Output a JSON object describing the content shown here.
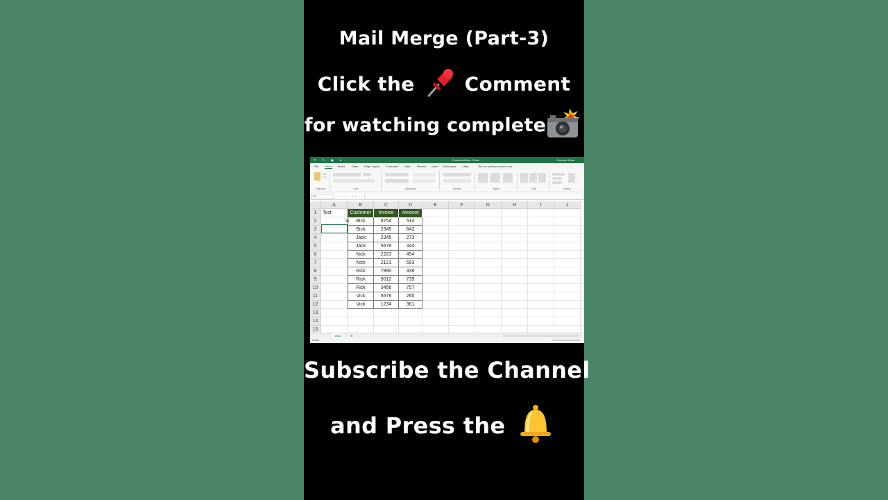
{
  "headline": {
    "line1": "Mail Merge (Part-3)",
    "line2_a": "Click the",
    "line2_b": "Comment",
    "line3": "for watching complete",
    "line4": "Subscribe the Channel",
    "line5": "and Press the"
  },
  "icons": {
    "pin": "pushpin-icon",
    "camera": "camera-flash-icon",
    "bell": "bell-icon"
  },
  "excel": {
    "title": "CustomerData - Excel",
    "user": "Khurram Khan",
    "tabs": [
      "File",
      "Home",
      "Insert",
      "Draw",
      "Page Layout",
      "Formulas",
      "Data",
      "Review",
      "View",
      "Developer",
      "Help",
      "Tell me what you want to do"
    ],
    "groups": [
      "Clipboard",
      "Font",
      "Alignment",
      "Number",
      "Styles",
      "Cells",
      "Editing"
    ],
    "name_box": "A1",
    "columns": [
      "A",
      "B",
      "C",
      "D",
      "E",
      "F",
      "G",
      "H",
      "I",
      "J"
    ],
    "rows": [
      "1",
      "2",
      "3",
      "4",
      "5",
      "6",
      "7",
      "8",
      "9",
      "10",
      "11",
      "12",
      "13",
      "14",
      "15"
    ],
    "a1": "Test",
    "headers": [
      "Customer",
      "Invoice",
      "Amount"
    ],
    "data": [
      [
        "Bick",
        "6754",
        "514"
      ],
      [
        "Bick",
        "2345",
        "642"
      ],
      [
        "Jack",
        "2345",
        "273"
      ],
      [
        "Jack",
        "5678",
        "344"
      ],
      [
        "Nick",
        "2223",
        "454"
      ],
      [
        "Nick",
        "2121",
        "593"
      ],
      [
        "Rick",
        "7890",
        "336"
      ],
      [
        "Rick",
        "9012",
        "739"
      ],
      [
        "Rick",
        "3456",
        "757"
      ],
      [
        "Vick",
        "5678",
        "260"
      ],
      [
        "Vick",
        "1234",
        "361"
      ]
    ],
    "sheet_tab": "Data",
    "status": "Ready"
  },
  "colors": {
    "background": "#4b8567",
    "panel": "#000000",
    "excel_green": "#217346",
    "header_fill": "#375623"
  }
}
